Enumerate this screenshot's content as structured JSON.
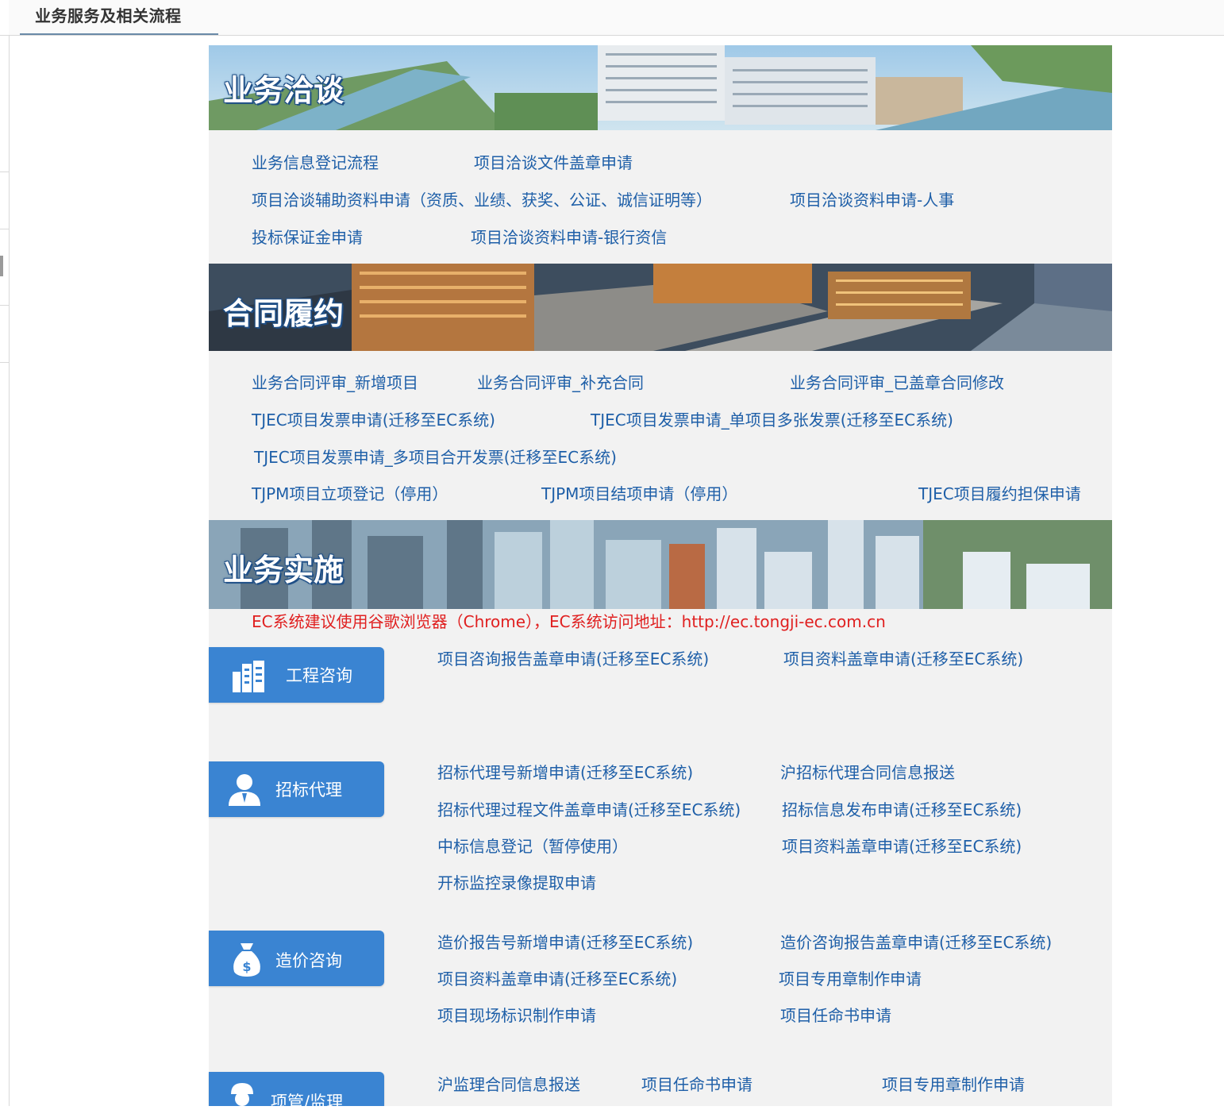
{
  "header": {
    "tab_title": "业务服务及相关流程"
  },
  "colors": {
    "link": "#1e5fa8",
    "accent": "#3a84d2",
    "note": "#e02020",
    "panel_bg": "#f2f2f2"
  },
  "sections": {
    "negotiation": {
      "title": "业务洽谈",
      "links": [
        "业务信息登记流程",
        "项目洽谈文件盖章申请",
        "项目洽谈辅助资料申请（资质、业绩、获奖、公证、诚信证明等）",
        "项目洽谈资料申请-人事",
        "投标保证金申请",
        "项目洽谈资料申请-银行资信"
      ]
    },
    "contract": {
      "title": "合同履约",
      "links": [
        "业务合同评审_新增项目",
        "业务合同评审_补充合同",
        "业务合同评审_已盖章合同修改",
        "TJEC项目发票申请(迁移至EC系统)",
        "TJEC项目发票申请_单项目多张发票(迁移至EC系统)",
        "TJEC项目发票申请_多项目合开发票(迁移至EC系统)",
        "TJPM项目立项登记（停用）",
        "TJPM项目结项申请（停用）",
        "TJEC项目履约担保申请"
      ]
    },
    "implementation": {
      "title": "业务实施",
      "note": "EC系统建议使用谷歌浏览器（Chrome），EC系统访问地址：http://ec.tongji-ec.com.cn"
    }
  },
  "categories": {
    "engineering": {
      "label": "工程咨询",
      "icon": "building-icon",
      "links": [
        "项目咨询报告盖章申请(迁移至EC系统)",
        "项目资料盖章申请(迁移至EC系统)"
      ]
    },
    "bidding": {
      "label": "招标代理",
      "icon": "person-icon",
      "links": [
        "招标代理号新增申请(迁移至EC系统)",
        "沪招标代理合同信息报送",
        "招标代理过程文件盖章申请(迁移至EC系统)",
        "招标信息发布申请(迁移至EC系统)",
        "中标信息登记（暂停使用）",
        "项目资料盖章申请(迁移至EC系统)",
        "开标监控录像提取申请"
      ]
    },
    "cost": {
      "label": "造价咨询",
      "icon": "money-bag-icon",
      "links": [
        "造价报告号新增申请(迁移至EC系统)",
        "造价咨询报告盖章申请(迁移至EC系统)",
        "项目资料盖章申请(迁移至EC系统)",
        "项目专用章制作申请",
        "项目现场标识制作申请",
        "项目任命书申请"
      ]
    },
    "supervision": {
      "label": "项管/监理",
      "icon": "worker-icon",
      "links": [
        "沪监理合同信息报送",
        "项目任命书申请",
        "项目专用章制作申请"
      ]
    }
  }
}
